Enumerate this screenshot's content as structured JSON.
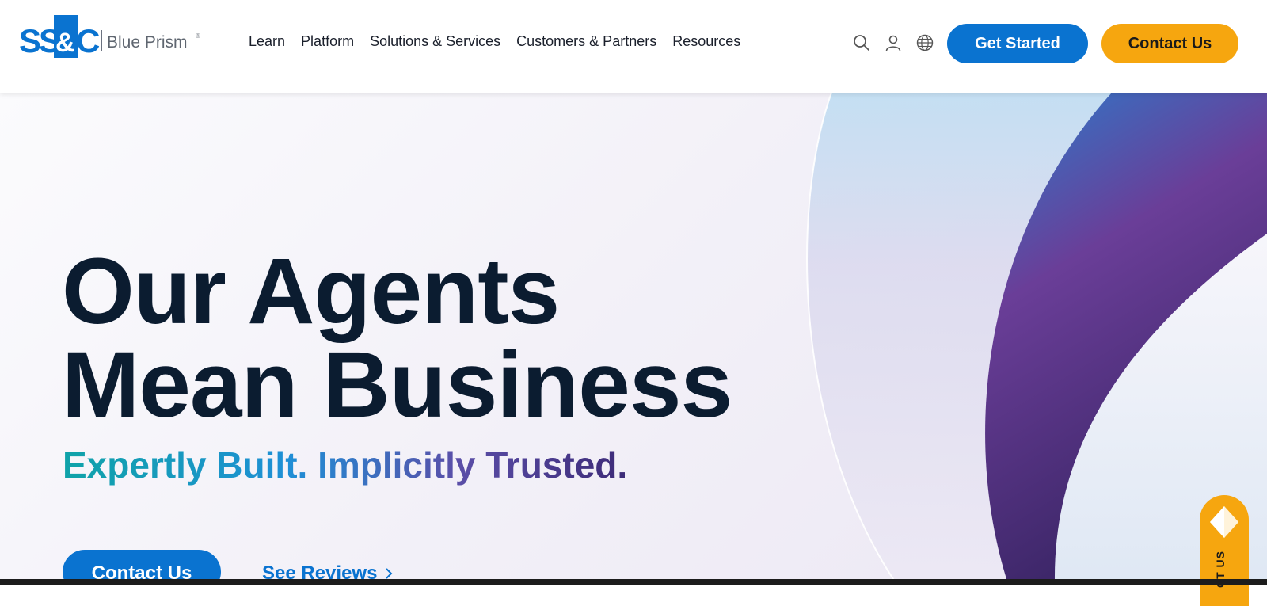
{
  "brand": {
    "logo_mark": "SS&C",
    "logo_text": "Blue Prism",
    "logo_reg": "®"
  },
  "nav": {
    "items": [
      {
        "label": "Learn"
      },
      {
        "label": "Platform"
      },
      {
        "label": "Solutions & Services"
      },
      {
        "label": "Customers & Partners"
      },
      {
        "label": "Resources"
      }
    ]
  },
  "header_icons": [
    "search-icon",
    "user-icon",
    "globe-icon"
  ],
  "header_buttons": {
    "get_started": "Get Started",
    "contact_us": "Contact Us"
  },
  "hero": {
    "headline_line1": "Our Agents",
    "headline_line2": "Mean Business",
    "tagline": "Expertly Built. Implicitly Trusted.",
    "cta_label": "Contact Us",
    "link_label": "See Reviews"
  },
  "floating_tab": {
    "label": "CT US"
  },
  "colors": {
    "primary_blue": "#0a73d0",
    "accent_orange": "#f6a60f",
    "headline": "#0b1c30",
    "purple": "#5a3c8c"
  }
}
